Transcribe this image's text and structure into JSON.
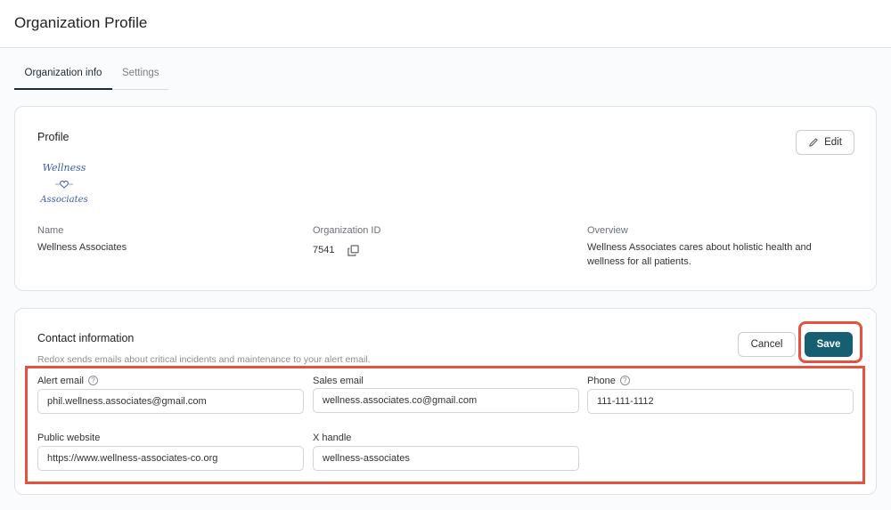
{
  "header": {
    "title": "Organization Profile"
  },
  "tabs": [
    {
      "label": "Organization info",
      "active": true
    },
    {
      "label": "Settings",
      "active": false
    }
  ],
  "profile": {
    "title": "Profile",
    "edit_label": "Edit",
    "edit_icon": "pencil-icon",
    "logo": {
      "line1": "Wellness",
      "line2": "Associates",
      "icon": "heart-icon"
    },
    "name_label": "Name",
    "name_value": "Wellness Associates",
    "org_id_label": "Organization ID",
    "org_id_value": "7541",
    "copy_icon": "copy-icon",
    "overview_label": "Overview",
    "overview_value": "Wellness Associates cares about holistic health and wellness for all patients."
  },
  "contact": {
    "title": "Contact information",
    "subtitle": "Redox sends emails about critical incidents and maintenance to your alert email.",
    "cancel_label": "Cancel",
    "save_label": "Save",
    "help_icon": "help-circle-icon",
    "fields": {
      "alert_email": {
        "label": "Alert email",
        "value": "phil.wellness.associates@gmail.com"
      },
      "sales_email": {
        "label": "Sales email",
        "value": "wellness.associates.co@gmail.com"
      },
      "phone": {
        "label": "Phone",
        "value": "111-111-1112"
      },
      "public_website": {
        "label": "Public website",
        "value": "https://www.wellness-associates-co.org"
      },
      "x_handle": {
        "label": "X handle",
        "value": "wellness-associates"
      }
    }
  },
  "colors": {
    "primary": "#155f73",
    "highlight": "#e5503f",
    "logo_ink": "#3a5fa8"
  }
}
